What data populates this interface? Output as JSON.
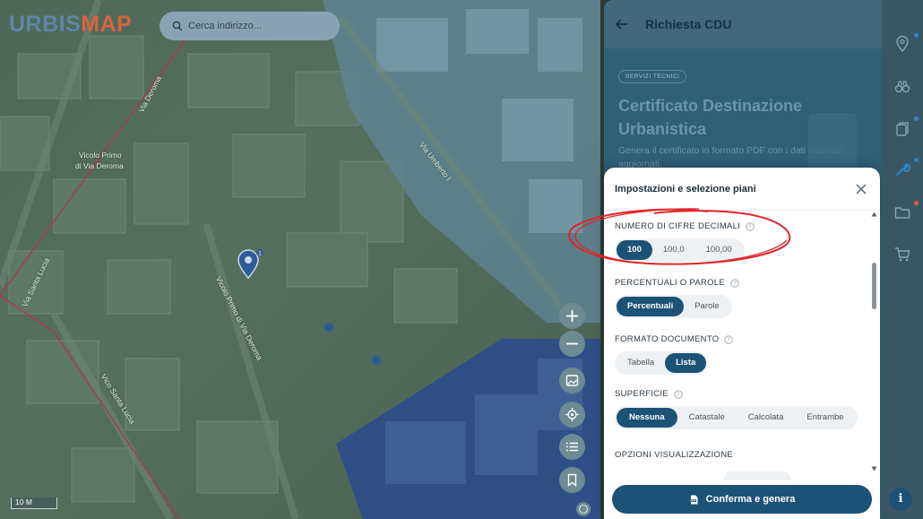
{
  "app": {
    "logo_part1": "URBIS",
    "logo_part2": "MAP",
    "brand_blue": "#5f86a8",
    "brand_orange": "#d9633f"
  },
  "search": {
    "placeholder": "Cerca indirizzo..."
  },
  "map": {
    "street_labels": [
      "Via Deroma",
      "Vicolo Primo",
      "di Via Deroma",
      "Vicolo Primo di Via Deroma",
      "Via Umberto I",
      "Vico Santa Lucia",
      "Via Santa Lucia"
    ],
    "marker_badge": "1",
    "scale_label": "10 M",
    "controls": [
      "zoom-in",
      "zoom-out",
      "layers",
      "locate",
      "list",
      "bookmark"
    ]
  },
  "panel": {
    "title": "Richiesta CDU",
    "badge": "SERVIZI TECNICI",
    "heading": "Certificato Destinazione Urbanistica",
    "description": "Genera il certificato in formato PDF con i dati catastali aggiornati."
  },
  "modal": {
    "title": "Impostazioni e selezione piani",
    "sections": {
      "decimali": {
        "label": "NUMERO DI CIFRE DECIMALI",
        "options": [
          "100",
          "100,0",
          "100,00"
        ],
        "selected": "100"
      },
      "percentuali": {
        "label": "PERCENTUALI O PAROLE",
        "options": [
          "Percentuali",
          "Parole"
        ],
        "selected": "Percentuali"
      },
      "formato": {
        "label": "FORMATO DOCUMENTO",
        "options": [
          "Tabella",
          "Lista"
        ],
        "selected": "Lista"
      },
      "superficie": {
        "label": "SUPERFICIE",
        "options": [
          "Nessuna",
          "Catastale",
          "Calcolata",
          "Entrambe"
        ],
        "selected": "Nessuna"
      },
      "visualizzazione": {
        "label": "OPZIONI VISUALIZZAZIONE"
      }
    },
    "confirm_label": "Conferma e genera",
    "accent": "#1d5277",
    "annotation_color": "#e0262b"
  },
  "rightbar": {
    "icons": [
      "map-pin-icon",
      "binoculars-icon",
      "documents-icon",
      "wrench-icon",
      "folder-icon",
      "cart-icon"
    ],
    "info_label": "i"
  }
}
